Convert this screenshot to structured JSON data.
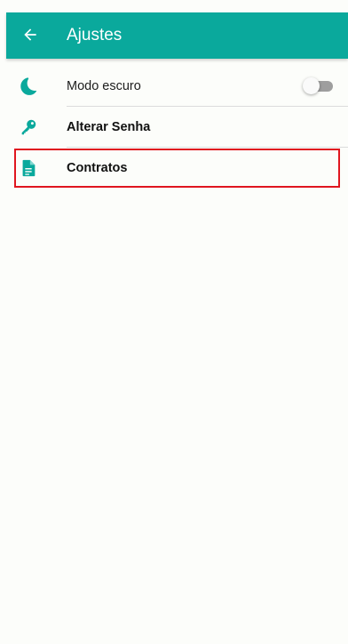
{
  "appbar": {
    "title": "Ajustes",
    "back_icon": "arrow-left-icon",
    "background_color": "#0aa99c"
  },
  "settings": {
    "items": [
      {
        "label": "Modo escuro",
        "icon": "moon-icon",
        "type": "toggle",
        "toggle_on": false
      },
      {
        "label": "Alterar Senha",
        "icon": "key-icon",
        "type": "link"
      },
      {
        "label": "Contratos",
        "icon": "document-icon",
        "type": "link"
      }
    ]
  },
  "accent_color": "#0aa99c",
  "highlight_color": "#e0161f"
}
